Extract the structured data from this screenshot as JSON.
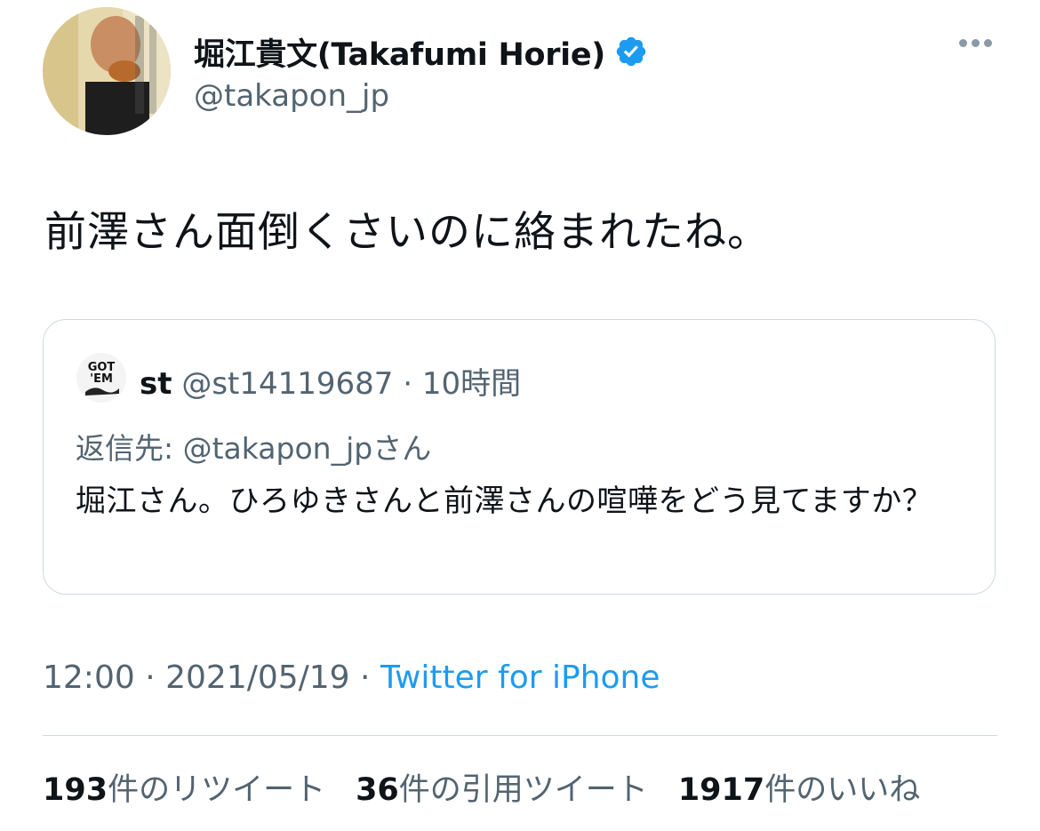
{
  "author": {
    "display_name": "堀江貴文(Takafumi Horie)",
    "handle": "@takapon_jp",
    "verified": true
  },
  "tweet": {
    "text": "前澤さん面倒くさいのに絡まれたね。"
  },
  "quoted_tweet": {
    "name": "st",
    "handle": "@st14119687",
    "separator": "·",
    "time": "10時間",
    "reply_prefix": "返信先: ",
    "reply_to": "@takapon_jpさん",
    "text": "堀江さん。ひろゆきさんと前澤さんの喧嘩をどう見てますか？"
  },
  "meta": {
    "time": "12:00",
    "separator1": " · ",
    "date": "2021/05/19",
    "separator2": " · ",
    "source": "Twitter for iPhone"
  },
  "stats": {
    "retweets_count": "193",
    "retweets_label": "件のリツイート",
    "quotes_count": "36",
    "quotes_label": "件の引用ツイート",
    "likes_count": "1917",
    "likes_label": "件のいいね"
  },
  "colors": {
    "link": "#1d9bf0",
    "secondary_text": "#536471",
    "border": "#cfd9de",
    "verified_badge": "#1d9bf0"
  },
  "icons": {
    "verified": "verified-badge-icon",
    "more": "more-dots-icon"
  }
}
